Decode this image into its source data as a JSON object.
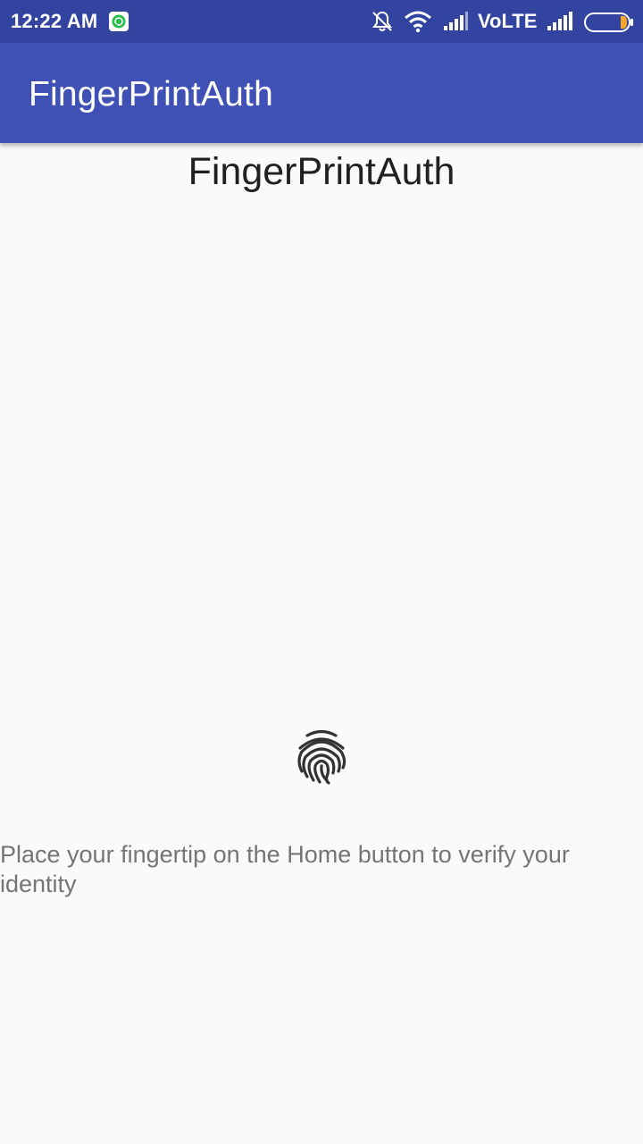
{
  "status_bar": {
    "time": "12:22 AM",
    "network_label": "VoLTE",
    "icons": [
      "whatsapp-icon",
      "muted-bell-icon",
      "wifi-icon",
      "signal-icon",
      "signal-icon",
      "battery-icon"
    ],
    "background": "#3344a0"
  },
  "app_bar": {
    "title": "FingerPrintAuth",
    "background": "#3f51b5"
  },
  "main": {
    "heading": "FingerPrintAuth",
    "fingerprint_icon": "fingerprint-icon",
    "instruction": "Place your fingertip on the Home button to verify your identity"
  },
  "colors": {
    "accent_battery": "#f5a623",
    "page_background": "#fafafa"
  }
}
